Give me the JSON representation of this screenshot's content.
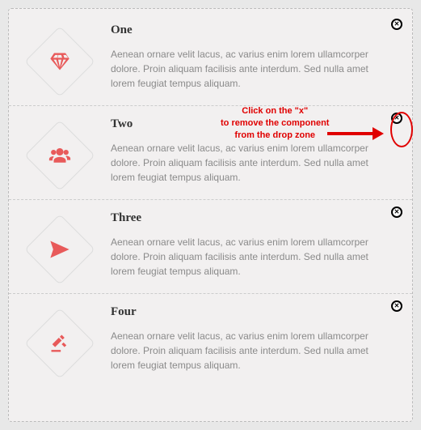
{
  "annotation": {
    "line1": "Click on the \"x\"",
    "line2": "to remove the component",
    "line3": "from the drop zone"
  },
  "items": [
    {
      "title": "One",
      "icon": "diamond",
      "desc": "Aenean ornare velit lacus, ac varius enim lorem ullamcorper dolore. Proin aliquam facilisis ante interdum. Sed nulla amet lorem feugiat tempus aliquam."
    },
    {
      "title": "Two",
      "icon": "users",
      "desc": "Aenean ornare velit lacus, ac varius enim lorem ullamcorper dolore. Proin aliquam facilisis ante interdum. Sed nulla amet lorem feugiat tempus aliquam."
    },
    {
      "title": "Three",
      "icon": "paper-plane",
      "desc": "Aenean ornare velit lacus, ac varius enim lorem ullamcorper dolore. Proin aliquam facilisis ante interdum. Sed nulla amet lorem feugiat tempus aliquam."
    },
    {
      "title": "Four",
      "icon": "gavel",
      "desc": "Aenean ornare velit lacus, ac varius enim lorem ullamcorper dolore. Proin aliquam facilisis ante interdum. Sed nulla amet lorem feugiat tempus aliquam."
    }
  ]
}
